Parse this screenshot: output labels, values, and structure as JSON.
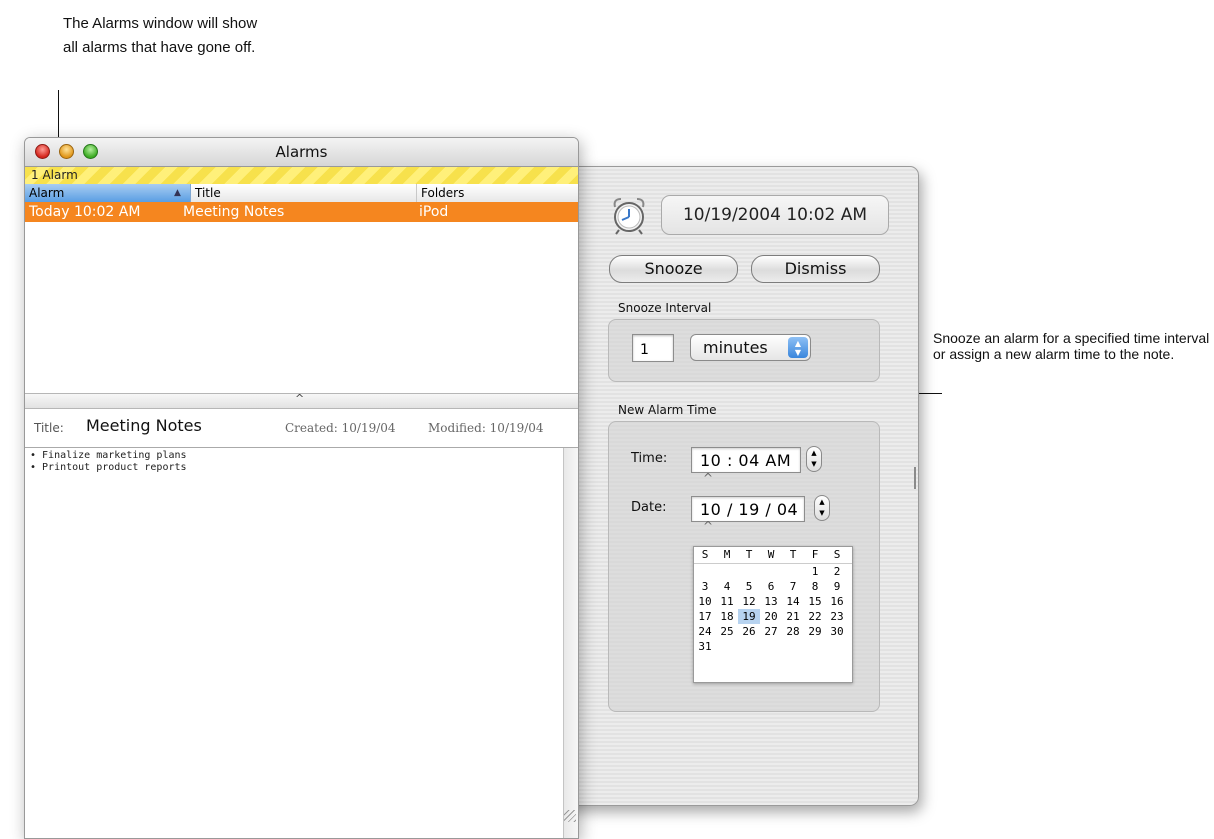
{
  "annotations": {
    "top": "The Alarms window will show all alarms that have gone off.",
    "right": "Snooze an alarm for a specified time interval or assign a new alarm time to the note."
  },
  "window": {
    "title": "Alarms",
    "banner": "1 Alarm",
    "columns": [
      "Alarm",
      "Title",
      "Folders"
    ],
    "rows": [
      {
        "alarm": "Today 10:02 AM",
        "title": "Meeting Notes",
        "folders": "iPod"
      }
    ],
    "selected_row_color": "#f5861f"
  },
  "note": {
    "title_label": "Title:",
    "title": "Meeting Notes",
    "created": "Created: 10/19/04",
    "modified": "Modified: 10/19/04",
    "lines": [
      "• Finalize marketing plans",
      "• Printout product reports"
    ]
  },
  "drawer": {
    "alarm_datetime": "10/19/2004 10:02 AM",
    "snooze_button": "Snooze",
    "dismiss_button": "Dismiss",
    "snooze_interval_label": "Snooze Interval",
    "snooze_value": "1",
    "snooze_unit": "minutes",
    "new_alarm_label": "New Alarm Time",
    "time_label": "Time:",
    "time_value": "10 : 04 AM",
    "date_label": "Date:",
    "date_value": "10 / 19 / 04",
    "calendar": {
      "weekdays": [
        "S",
        "M",
        "T",
        "W",
        "T",
        "F",
        "S"
      ],
      "weeks": [
        [
          "",
          "",
          "",
          "",
          "",
          "1",
          "2"
        ],
        [
          "3",
          "4",
          "5",
          "6",
          "7",
          "8",
          "9"
        ],
        [
          "10",
          "11",
          "12",
          "13",
          "14",
          "15",
          "16"
        ],
        [
          "17",
          "18",
          "19",
          "20",
          "21",
          "22",
          "23"
        ],
        [
          "24",
          "25",
          "26",
          "27",
          "28",
          "29",
          "30"
        ],
        [
          "31",
          "",
          "",
          "",
          "",
          "",
          ""
        ]
      ],
      "selected_day": "19"
    }
  }
}
